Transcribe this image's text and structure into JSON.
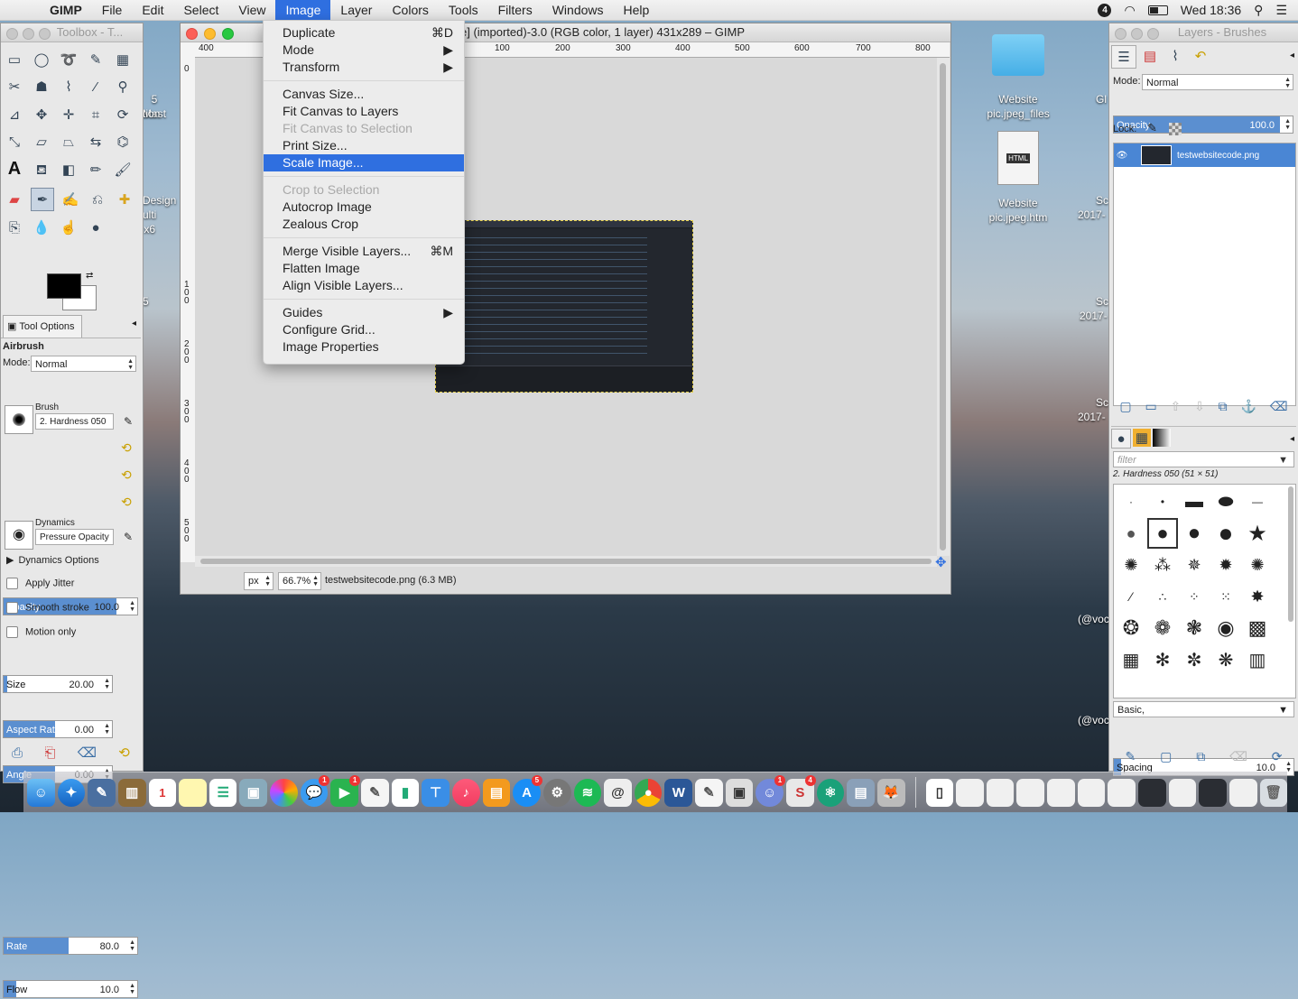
{
  "menubar": {
    "app": "GIMP",
    "items": [
      "File",
      "Edit",
      "Select",
      "View",
      "Image",
      "Layer",
      "Colors",
      "Tools",
      "Filters",
      "Windows",
      "Help"
    ],
    "active": "Image",
    "notification_count": "4",
    "clock": "Wed 18:36"
  },
  "toolbox": {
    "title": "Toolbox - T...",
    "tool_options_tab": "Tool Options",
    "tool_name": "Airbrush",
    "mode_label": "Mode:",
    "mode_value": "Normal",
    "opacity_label": "Opacity",
    "opacity_value": "100.0",
    "brush_label": "Brush",
    "brush_value": "2. Hardness 050",
    "size_label": "Size",
    "size_value": "20.00",
    "aspect_label": "Aspect Ratio",
    "aspect_value": "0.00",
    "angle_label": "Angle",
    "angle_value": "0.00",
    "dynamics_label": "Dynamics",
    "dynamics_value": "Pressure Opacity",
    "dynamics_options": "Dynamics Options",
    "apply_jitter": "Apply Jitter",
    "smooth_stroke": "Smooth stroke",
    "motion_only": "Motion only",
    "rate_label": "Rate",
    "rate_value": "80.0",
    "flow_label": "Flow",
    "flow_value": "10.0"
  },
  "image_window": {
    "title": "e] (imported)-3.0 (RGB color, 1 layer) 431x289 – GIMP",
    "ruler_h": [
      "400",
      "100",
      "200",
      "300",
      "400",
      "500",
      "600",
      "700",
      "800"
    ],
    "ruler_v": [
      "0",
      "1 0 0",
      "2 0 0",
      "3 0 0",
      "4 0 0",
      "5 0 0"
    ],
    "unit": "px",
    "zoom": "66.7%",
    "status": "testwebsitecode.png (6.3 MB)"
  },
  "image_menu": {
    "groups": [
      [
        {
          "label": "Duplicate",
          "shortcut": "⌘D"
        },
        {
          "label": "Mode",
          "submenu": true
        },
        {
          "label": "Transform",
          "submenu": true
        }
      ],
      [
        {
          "label": "Canvas Size..."
        },
        {
          "label": "Fit Canvas to Layers"
        },
        {
          "label": "Fit Canvas to Selection",
          "disabled": true
        },
        {
          "label": "Print Size..."
        },
        {
          "label": "Scale Image...",
          "highlighted": true
        }
      ],
      [
        {
          "label": "Crop to Selection",
          "disabled": true
        },
        {
          "label": "Autocrop Image"
        },
        {
          "label": "Zealous Crop"
        }
      ],
      [
        {
          "label": "Merge Visible Layers...",
          "shortcut": "⌘M"
        },
        {
          "label": "Flatten Image"
        },
        {
          "label": "Align Visible Layers..."
        }
      ],
      [
        {
          "label": "Guides",
          "submenu": true
        },
        {
          "label": "Configure Grid..."
        },
        {
          "label": "Image Properties"
        }
      ]
    ]
  },
  "layers_panel": {
    "title": "Layers - Brushes",
    "mode_label": "Mode:",
    "mode_value": "Normal",
    "opacity_label": "Opacity",
    "opacity_value": "100.0",
    "lock_label": "Lock:",
    "layer_name": "testwebsitecode.png",
    "filter_placeholder": "filter",
    "brush_name": "2. Hardness 050 (51 × 51)",
    "brush_set": "Basic,",
    "spacing_label": "Spacing",
    "spacing_value": "10.0"
  },
  "desktop": {
    "icons": [
      {
        "label1": "Website",
        "label2": "pic.jpeg_files"
      },
      {
        "label1": "Website",
        "label2": "pic.jpeg.htm"
      }
    ],
    "html_badge": "HTML",
    "partial_labels": [
      "5 Mast",
      "tion",
      "Design",
      "ulti x6",
      "5",
      "Gl",
      "Sc",
      "2017-",
      "Sc",
      "2017-",
      "Sc",
      "2017-",
      "(@voc",
      "(@voc"
    ]
  },
  "dock": {
    "calendar_day": "1",
    "badges": [
      "1",
      "1",
      "5",
      "4"
    ]
  },
  "colors": {
    "accent": "#2f6fe0",
    "slider_fill": "#5b8fd0"
  }
}
